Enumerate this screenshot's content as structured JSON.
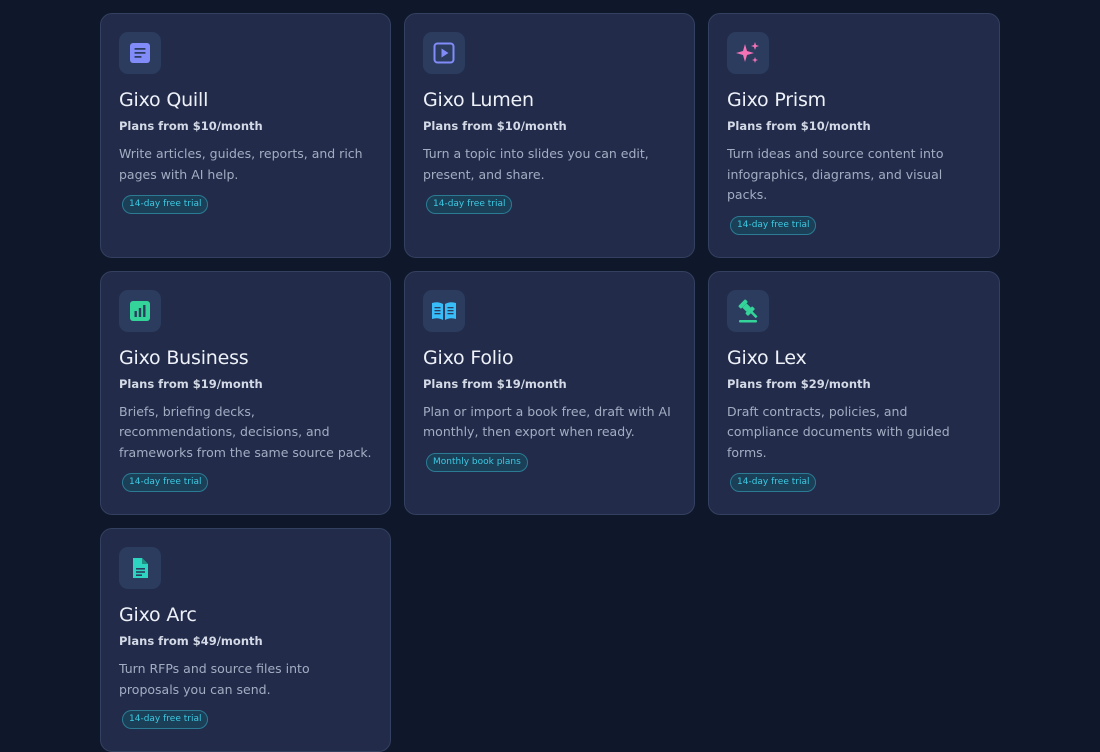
{
  "products": [
    {
      "name": "Gixo Quill",
      "price": "Plans from $10/month",
      "description": "Write articles, guides, reports, and rich pages with AI help.",
      "badge": "14-day free trial",
      "icon": "document-icon",
      "icon_color": "#818cf8"
    },
    {
      "name": "Gixo Lumen",
      "price": "Plans from $10/month",
      "description": "Turn a topic into slides you can edit, present, and share.",
      "badge": "14-day free trial",
      "icon": "play-icon",
      "icon_color": "#818cf8"
    },
    {
      "name": "Gixo Prism",
      "price": "Plans from $10/month",
      "description": "Turn ideas and source content into infographics, diagrams, and visual packs.",
      "badge": "14-day free trial",
      "icon": "sparkle-icon",
      "icon_color": "#f472b6"
    },
    {
      "name": "Gixo Business",
      "price": "Plans from $19/month",
      "description": "Briefs, briefing decks, recommendations, decisions, and frameworks from the same source pack.",
      "badge": "14-day free trial",
      "icon": "bar-chart-icon",
      "icon_color": "#34d399"
    },
    {
      "name": "Gixo Folio",
      "price": "Plans from $19/month",
      "description": "Plan or import a book free, draft with AI monthly, then export when ready.",
      "badge": "Monthly book plans",
      "icon": "open-book-icon",
      "icon_color": "#38bdf8"
    },
    {
      "name": "Gixo Lex",
      "price": "Plans from $29/month",
      "description": "Draft contracts, policies, and compliance documents with guided forms.",
      "badge": "14-day free trial",
      "icon": "gavel-icon",
      "icon_color": "#34d399"
    },
    {
      "name": "Gixo Arc",
      "price": "Plans from $49/month",
      "description": "Turn RFPs and source files into proposals you can send.",
      "badge": "14-day free trial",
      "icon": "file-text-icon",
      "icon_color": "#2dd4bf"
    }
  ]
}
